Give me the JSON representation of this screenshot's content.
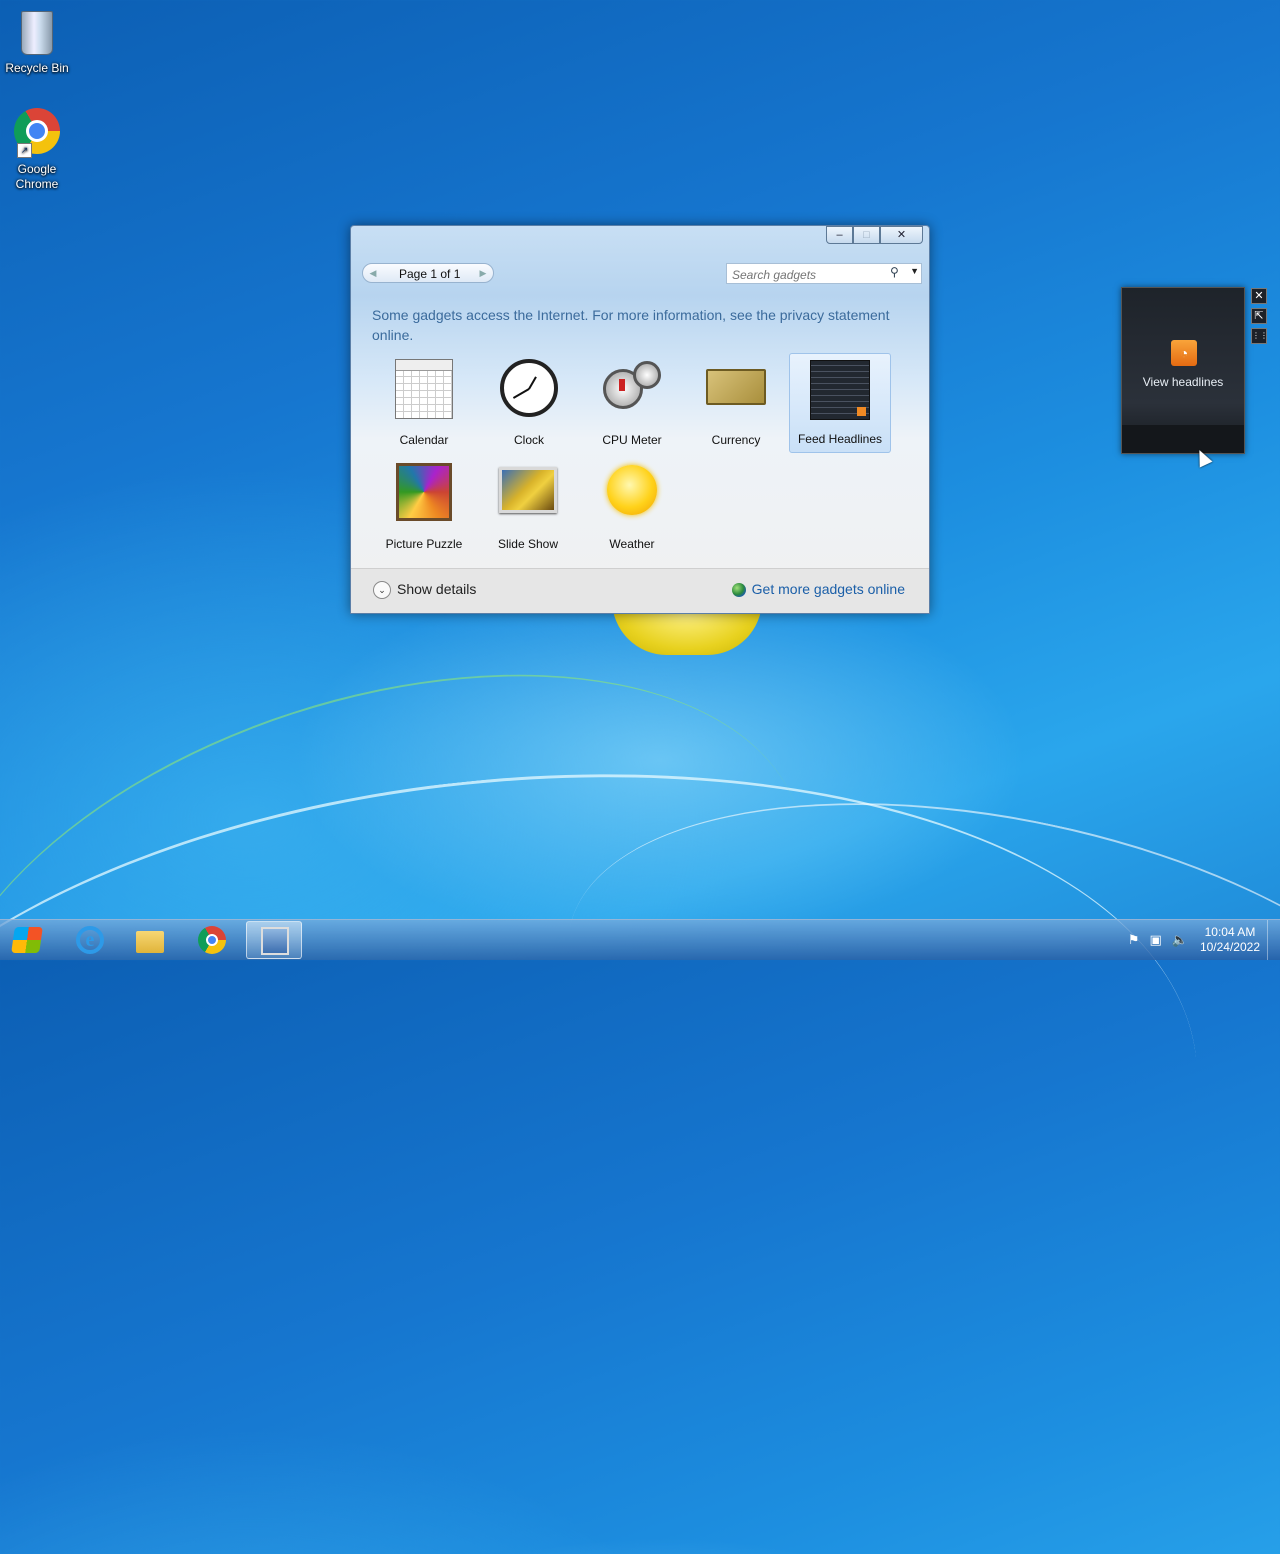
{
  "desktop": {
    "icons": [
      {
        "label": "Recycle Bin",
        "icon": "recycle-bin-icon"
      },
      {
        "label": "Google\nChrome",
        "icon": "chrome-icon"
      }
    ]
  },
  "gallery": {
    "window_buttons": {
      "minimize": "–",
      "maximize": "□",
      "close": "✕"
    },
    "pager": {
      "text": "Page 1 of 1",
      "prev": "◀",
      "next": "▶"
    },
    "search": {
      "placeholder": "Search gadgets",
      "value": ""
    },
    "notice": "Some gadgets access the Internet.  For more information, see the privacy statement online.",
    "gadgets": [
      {
        "label": "Calendar",
        "icon": "calendar-gadget-icon"
      },
      {
        "label": "Clock",
        "icon": "clock-gadget-icon"
      },
      {
        "label": "CPU Meter",
        "icon": "cpu-meter-gadget-icon"
      },
      {
        "label": "Currency",
        "icon": "currency-gadget-icon"
      },
      {
        "label": "Feed Headlines",
        "icon": "feed-headlines-gadget-icon",
        "selected": true
      },
      {
        "label": "Picture Puzzle",
        "icon": "picture-puzzle-gadget-icon"
      },
      {
        "label": "Slide Show",
        "icon": "slide-show-gadget-icon"
      },
      {
        "label": "Weather",
        "icon": "weather-gadget-icon"
      }
    ],
    "footer": {
      "show_details": "Show details",
      "get_more": "Get more gadgets online"
    }
  },
  "feed_gadget": {
    "label": "View headlines",
    "tools": {
      "close": "✕",
      "size": "⇱",
      "drag": "⋮⋮"
    }
  },
  "taskbar": {
    "clock_time": "10:04 AM",
    "clock_date": "10/24/2022",
    "pinned": [
      "Internet Explorer",
      "Windows Explorer",
      "Google Chrome",
      "Desktop Gadget Gallery"
    ]
  }
}
